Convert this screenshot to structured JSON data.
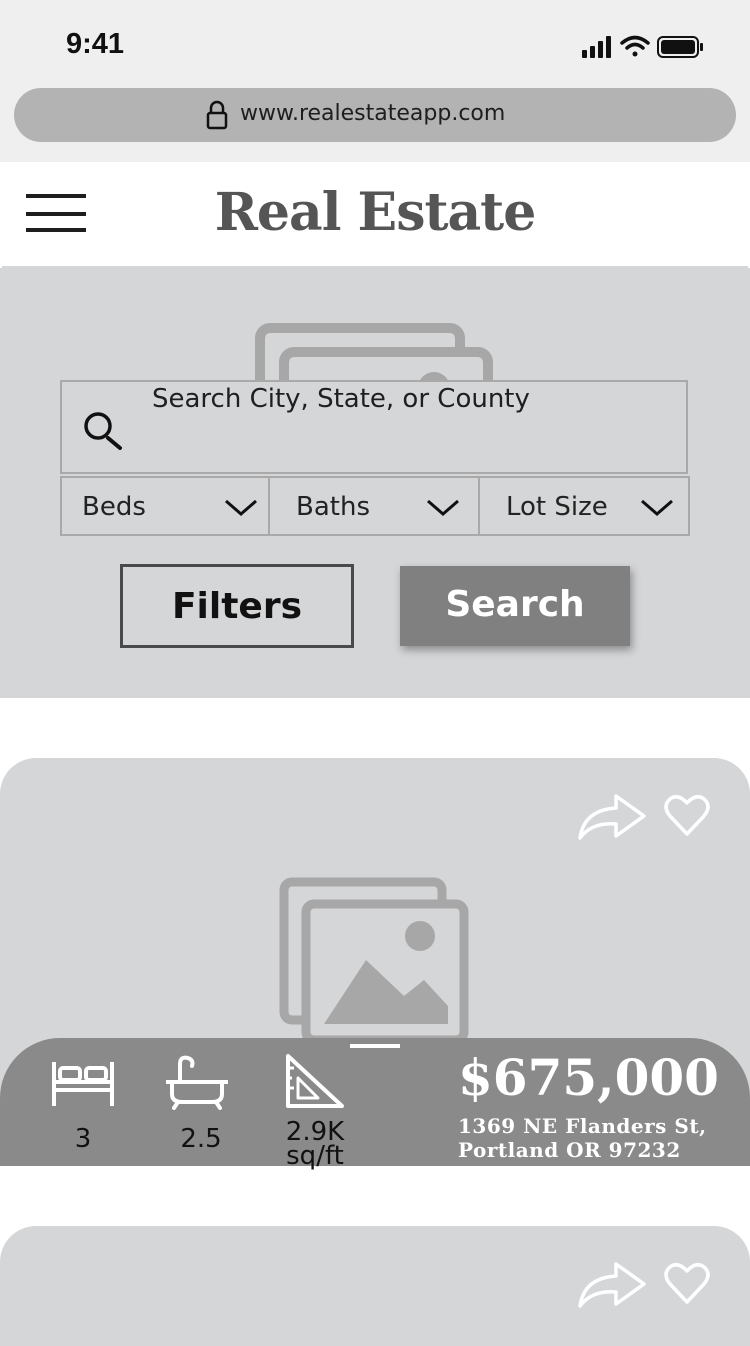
{
  "status_bar": {
    "time": "9:41"
  },
  "browser": {
    "url": "www.realestateapp.com"
  },
  "header": {
    "title": "Real Estate"
  },
  "search": {
    "placeholder": "Search City, State, or County",
    "dropdowns": [
      {
        "label": "Beds"
      },
      {
        "label": "Baths"
      },
      {
        "label": "Lot Size"
      }
    ],
    "filters_label": "Filters",
    "search_label": "Search"
  },
  "listings": [
    {
      "beds": "3",
      "baths": "2.5",
      "size_line1": "2.9K",
      "size_line2": "sq/ft",
      "price": "$675,000",
      "address_line1": "1369 NE Flanders St,",
      "address_line2": "Portland OR 97232"
    }
  ],
  "icons": [
    "lock-icon",
    "signal-icon",
    "wifi-icon",
    "battery-icon",
    "hamburger-icon",
    "image-placeholder-icon",
    "search-icon",
    "chevron-down-icon",
    "share-icon",
    "heart-icon",
    "bed-icon",
    "bathtub-icon",
    "ruler-triangle-icon"
  ],
  "colors": {
    "hero_bg": "#d5d6d8",
    "search_button": "#808080",
    "info_bar": "#8a8a8a",
    "status_bg": "#efefef"
  }
}
